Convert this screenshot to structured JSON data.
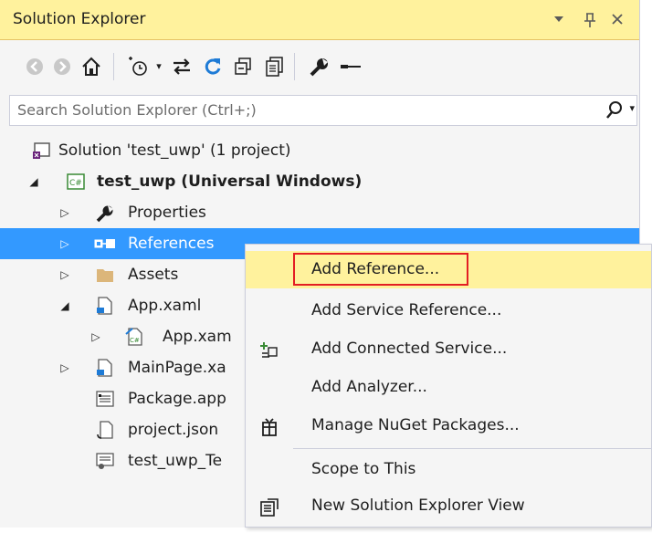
{
  "panel": {
    "title": "Solution Explorer",
    "controls": {
      "dropdown": "▼",
      "pin": "ᚁ",
      "close": "✕"
    }
  },
  "toolbar": {
    "buttons": [
      {
        "name": "back-icon"
      },
      {
        "name": "forward-icon"
      },
      {
        "name": "home-icon"
      },
      {
        "name": "pending-changes-icon"
      },
      {
        "name": "sync-active-icon"
      },
      {
        "name": "refresh-icon"
      },
      {
        "name": "collapse-all-icon"
      },
      {
        "name": "show-all-files-icon"
      },
      {
        "name": "properties-wrench-icon"
      },
      {
        "name": "preview-icon"
      }
    ]
  },
  "search": {
    "placeholder": "Search Solution Explorer (Ctrl+;)"
  },
  "tree": {
    "items": [
      {
        "label": "Solution 'test_uwp' (1 project)",
        "icon": "solution-icon"
      },
      {
        "label": "test_uwp (Universal Windows)",
        "icon": "csharp-project-icon",
        "expanded": true
      },
      {
        "label": "Properties",
        "icon": "wrench-icon"
      },
      {
        "label": "References",
        "icon": "references-icon",
        "selected": true
      },
      {
        "label": "Assets",
        "icon": "folder-icon"
      },
      {
        "label": "App.xaml",
        "icon": "xaml-file-icon",
        "expanded": true
      },
      {
        "label": "App.xam",
        "icon": "csharp-file-icon"
      },
      {
        "label": "MainPage.xa",
        "icon": "xaml-file-icon"
      },
      {
        "label": "Package.app",
        "icon": "manifest-icon"
      },
      {
        "label": "project.json",
        "icon": "json-file-icon"
      },
      {
        "label": "test_uwp_Te",
        "icon": "certificate-icon"
      }
    ]
  },
  "context_menu": {
    "items": [
      {
        "label": "Add Reference...",
        "highlighted": true
      },
      {
        "label": "Add Service Reference..."
      },
      {
        "label": "Add Connected Service...",
        "icon": "connected-service-icon"
      },
      {
        "label": "Add Analyzer..."
      },
      {
        "label": "Manage NuGet Packages...",
        "icon": "nuget-icon"
      },
      {
        "label": "Scope to This"
      },
      {
        "label": "New Solution Explorer View",
        "icon": "new-view-icon"
      }
    ]
  },
  "colors": {
    "title_bg": "#fff29d",
    "selection": "#3399ff",
    "highlight_box": "#e31e24",
    "hover": "#fff29d"
  }
}
